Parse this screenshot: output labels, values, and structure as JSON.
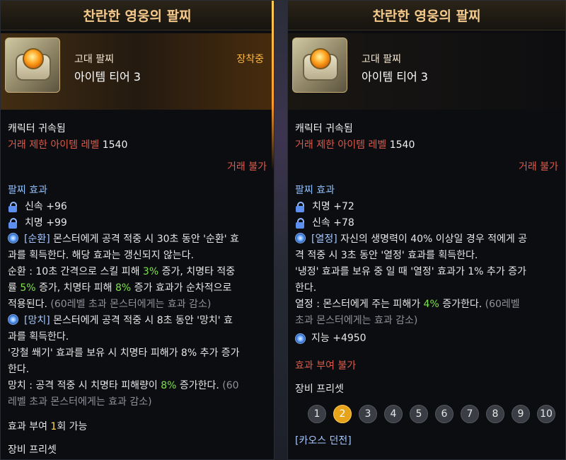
{
  "left": {
    "title": "찬란한 영웅의 팔찌",
    "grade": "고대 팔찌",
    "tier": "아이템 티어 3",
    "equipped": "장착중",
    "bound": "캐릭터 귀속됨",
    "trade_label": "거래 제한 아이템 레벨",
    "trade_value": "1540",
    "untradable": "거래 불가",
    "effect_header": "팔찌 효과",
    "stats": [
      {
        "name": "신속",
        "value": "+96"
      },
      {
        "name": "치명",
        "value": "+99"
      }
    ],
    "effects": [
      {
        "tag": "[순환]",
        "text1": " 몬스터에게 공격 적중 시 30초 동안 '순환' 효",
        "text2": "과를 획득한다. 해당 효과는 갱신되지 않는다."
      },
      {
        "tag": "[망치]",
        "text1": " 몬스터에게 공격 적중 시 8초 동안 '망치' 효",
        "text2": "과를 획득한다."
      }
    ],
    "cycle_desc": {
      "a": "순환 : 10초 간격으로 스킬 피해 ",
      "a_val": "3%",
      "b": " 증가, 치명타 적중",
      "c": "률 ",
      "c_val": "5%",
      "d": " 증가, 치명타 피해 ",
      "d_val": "8%",
      "e": " 증가 효과가 순차적으로",
      "f": "적용된다. ",
      "f_gray": "(60레벨 초과 몬스터에게는 효과 감소)"
    },
    "steel_desc": {
      "a": "'강철 쐐기' 효과를 보유 시 치명타 피해가 8% 추가 증가",
      "b": "한다."
    },
    "hammer_desc": {
      "a": "망치 : 공격 적중 시 치명타 피해량이 ",
      "a_val": "8%",
      "b": " 증가한다. ",
      "b_gray": "(60",
      "c_gray": "레벨 초과 몬스터에게는 효과 감소)"
    },
    "enchant": {
      "a": "효과 부여 ",
      "count": "1",
      "b": "회 가능"
    },
    "preset_cut": "장비 프리셋"
  },
  "right": {
    "title": "찬란한 영웅의 팔찌",
    "grade": "고대 팔찌",
    "tier": "아이템 티어 3",
    "bound": "캐릭터 귀속됨",
    "trade_label": "거래 제한 아이템 레벨",
    "trade_value": "1540",
    "untradable": "거래 불가",
    "effect_header": "팔찌 효과",
    "stats": [
      {
        "name": "치명",
        "value": "+72"
      },
      {
        "name": "신속",
        "value": "+78"
      }
    ],
    "fever": {
      "tag": "[열정]",
      "text1": " 자신의 생명력이 40% 이상일 경우 적에게 공",
      "text2": "격 적중 시 3초 동안 '열정' 효과를 획득한다."
    },
    "cold_desc": {
      "a": "'냉정' 효과를 보유 중 일 때 '열정' 효과가 1% 추가 증가",
      "b": "한다."
    },
    "fever_desc": {
      "a": "열정 : 몬스터에게 주는 피해가 ",
      "a_val": "4%",
      "b": " 증가한다. ",
      "b_gray": "(60레벨",
      "c_gray": "초과 몬스터에게는 효과 감소)"
    },
    "int_stat": {
      "name": "지능",
      "value": "+4950"
    },
    "no_enchant": "효과 부여 불가",
    "preset_header": "장비 프리셋",
    "presets": [
      "1",
      "2",
      "3",
      "4",
      "5",
      "6",
      "7",
      "8",
      "9",
      "10"
    ],
    "active_preset": "2",
    "chaos": "[카오스 던전]"
  },
  "colors": {
    "title": "#f4c98b",
    "red": "#e05a4a",
    "green": "#7ee24a",
    "accent": "#e7a41a",
    "section": "#8fc0ff"
  }
}
